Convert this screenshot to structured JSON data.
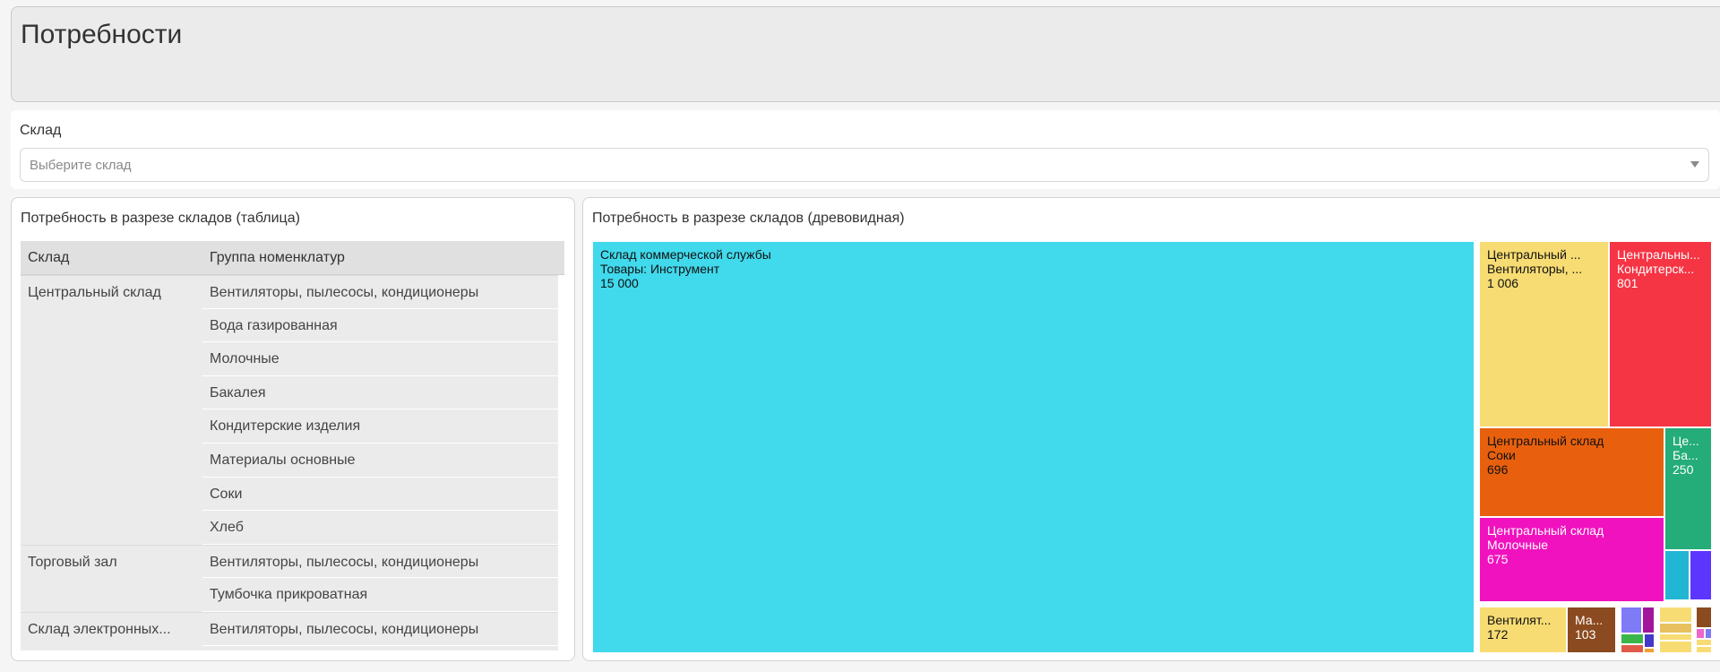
{
  "page": {
    "title": "Потребности"
  },
  "filter": {
    "label": "Склад",
    "placeholder": "Выберите склад"
  },
  "table_card": {
    "title": "Потребность в разрезе складов (таблица)",
    "columns": [
      "Склад",
      "Группа номенклатур"
    ],
    "rows": [
      {
        "warehouse": "Центральный склад",
        "group": "Вентиляторы, пылесосы, кондиционеры"
      },
      {
        "warehouse": "",
        "group": "Вода газированная"
      },
      {
        "warehouse": "",
        "group": "Молочные"
      },
      {
        "warehouse": "",
        "group": "Бакалея"
      },
      {
        "warehouse": "",
        "group": "Кондитерские изделия"
      },
      {
        "warehouse": "",
        "group": "Материалы основные"
      },
      {
        "warehouse": "",
        "group": "Соки"
      },
      {
        "warehouse": "",
        "group": "Хлеб"
      },
      {
        "warehouse": "Торговый зал",
        "group": "Вентиляторы, пылесосы, кондиционеры"
      },
      {
        "warehouse": "",
        "group": "Тумбочка прикроватная"
      },
      {
        "warehouse": "Склад электронных...",
        "group": "Вентиляторы, пылесосы, кондиционеры"
      }
    ]
  },
  "tree_card": {
    "title": "Потребность в разрезе складов (древовидная)"
  },
  "chart_data": {
    "type": "treemap",
    "tiles": [
      {
        "line1": "Склад коммерческой службы",
        "line2": "Товары: Инструмент",
        "value": "15 000",
        "color": "#41d9ec",
        "text_color": "#111111"
      },
      {
        "line1": "Центральный ...",
        "line2": "Вентиляторы, ...",
        "value": "1 006",
        "color": "#f7dc73",
        "text_color": "#111111"
      },
      {
        "line1": "Центральны...",
        "line2": "Кондитерск...",
        "value": "801",
        "color": "#f53444",
        "text_color": "#ffffff"
      },
      {
        "line1": "Центральный склад",
        "line2": "Соки",
        "value": "696",
        "color": "#e8600e",
        "text_color": "#111111"
      },
      {
        "line1": "Це...",
        "line2": "Ба...",
        "value": "250",
        "color": "#24ac79",
        "text_color": "#ffffff"
      },
      {
        "line1": "Центральный склад",
        "line2": "Молочные",
        "value": "675",
        "color": "#f012be",
        "text_color": "#ffffff"
      },
      {
        "line1": "",
        "line2": "",
        "value": "",
        "color": "#20b6d4",
        "text_color": "#ffffff"
      },
      {
        "line1": "",
        "line2": "",
        "value": "",
        "color": "#5c36ff",
        "text_color": "#ffffff"
      },
      {
        "line1": "Вентилят...",
        "line2": "",
        "value": "172",
        "color": "#f7dc73",
        "text_color": "#111111"
      },
      {
        "line1": "Ма...",
        "line2": "",
        "value": "103",
        "color": "#8b4a1f",
        "text_color": "#ffffff"
      },
      {
        "line1": "",
        "line2": "",
        "value": "",
        "color": "#7f7af5",
        "text_color": "#ffffff"
      },
      {
        "line1": "",
        "line2": "",
        "value": "",
        "color": "#a3169c",
        "text_color": "#ffffff"
      },
      {
        "line1": "",
        "line2": "",
        "value": "",
        "color": "#39b54a",
        "text_color": "#ffffff"
      },
      {
        "line1": "",
        "line2": "",
        "value": "",
        "color": "#4338c9",
        "text_color": "#ffffff"
      },
      {
        "line1": "",
        "line2": "",
        "value": "",
        "color": "#e05a4a",
        "text_color": "#ffffff"
      },
      {
        "line1": "",
        "line2": "",
        "value": "",
        "color": "#f0a030",
        "text_color": "#ffffff"
      },
      {
        "line1": "",
        "line2": "",
        "value": "",
        "color": "#f7dc73",
        "text_color": "#ffffff"
      },
      {
        "line1": "",
        "line2": "",
        "value": "",
        "color": "#e8c060",
        "text_color": "#ffffff"
      },
      {
        "line1": "",
        "line2": "",
        "value": "",
        "color": "#f7dc73",
        "text_color": "#ffffff"
      },
      {
        "line1": "",
        "line2": "",
        "value": "",
        "color": "#8b4a1f",
        "text_color": "#ffffff"
      },
      {
        "line1": "",
        "line2": "",
        "value": "",
        "color": "#f7dc73",
        "text_color": "#ffffff"
      },
      {
        "line1": "",
        "line2": "",
        "value": "",
        "color": "#ee66cc",
        "text_color": "#ffffff"
      },
      {
        "line1": "",
        "line2": "",
        "value": "",
        "color": "#7f7af5",
        "text_color": "#ffffff"
      },
      {
        "line1": "",
        "line2": "",
        "value": "",
        "color": "#f7dc73",
        "text_color": "#ffffff"
      },
      {
        "line1": "",
        "line2": "",
        "value": "",
        "color": "#f7dc73",
        "text_color": "#ffffff"
      }
    ]
  }
}
